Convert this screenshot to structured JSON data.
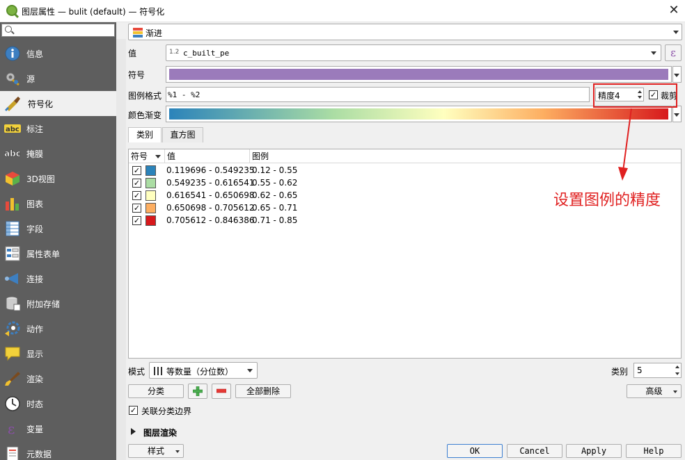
{
  "window": {
    "title": "图层属性 — bulit (default) — 符号化"
  },
  "sidebar": {
    "search_placeholder": "",
    "items": [
      {
        "label": "信息",
        "icon": "info-icon"
      },
      {
        "label": "源",
        "icon": "source-settings-icon"
      },
      {
        "label": "符号化",
        "icon": "paintbrush-icon"
      },
      {
        "label": "标注",
        "icon": "labels-abc-icon"
      },
      {
        "label": "掩膜",
        "icon": "mask-abc-icon"
      },
      {
        "label": "3D视图",
        "icon": "cube-3d-icon"
      },
      {
        "label": "图表",
        "icon": "diagram-icon"
      },
      {
        "label": "字段",
        "icon": "fields-icon"
      },
      {
        "label": "属性表单",
        "icon": "attribute-form-icon"
      },
      {
        "label": "连接",
        "icon": "joins-icon"
      },
      {
        "label": "附加存储",
        "icon": "auxiliary-storage-icon"
      },
      {
        "label": "动作",
        "icon": "actions-gear-icon"
      },
      {
        "label": "显示",
        "icon": "display-speech-icon"
      },
      {
        "label": "渲染",
        "icon": "rendering-brush-icon"
      },
      {
        "label": "时态",
        "icon": "temporal-clock-icon"
      },
      {
        "label": "变量",
        "icon": "variables-epsilon-icon"
      },
      {
        "label": "元数据",
        "icon": "metadata-icon"
      }
    ]
  },
  "renderer": {
    "type_label": "渐进"
  },
  "form": {
    "value_label": "值",
    "value_prefix": "1.2",
    "value_field": "c_built_pe",
    "expr_symbol": "ε",
    "symbol_label": "符号",
    "legend_format_label": "图例格式",
    "legend_format_value": "%1 - %2",
    "precision_value": "精度4",
    "trim_label": "裁剪",
    "color_ramp_label": "颜色渐变"
  },
  "tabs": [
    {
      "label": "类别"
    },
    {
      "label": "直方图"
    }
  ],
  "table": {
    "columns": [
      "符号",
      "值",
      "图例"
    ],
    "rows": [
      {
        "value": "0.119696 - 0.549235",
        "legend": "0.12 - 0.55",
        "color": "#2b83ba"
      },
      {
        "value": "0.549235 - 0.616541",
        "legend": "0.55 - 0.62",
        "color": "#abdda4"
      },
      {
        "value": "0.616541 - 0.650698",
        "legend": "0.62 - 0.65",
        "color": "#ffffbf"
      },
      {
        "value": "0.650698 - 0.705612",
        "legend": "0.65 - 0.71",
        "color": "#fdae61"
      },
      {
        "value": "0.705612 - 0.846386",
        "legend": "0.71 - 0.85",
        "color": "#d7191c"
      }
    ]
  },
  "bottom": {
    "mode_label": "模式",
    "mode_value": "等数量（分位数）",
    "classes_label": "类别",
    "classes_value": "5",
    "classify_button": "分类",
    "delete_all_button": "全部删除",
    "advanced_button": "高级",
    "link_boundaries_label": "关联分类边界",
    "layer_rendering_label": "图层渲染",
    "style_button": "样式",
    "ok_button": "OK",
    "cancel_button": "Cancel",
    "apply_button": "Apply",
    "help_button": "Help"
  },
  "annotation": {
    "text": "设置图例的精度"
  },
  "colors": {
    "symbol_fill": "#9b7bbb",
    "sidebar_bg": "#5e5e5e",
    "annotation": "#e02020"
  }
}
